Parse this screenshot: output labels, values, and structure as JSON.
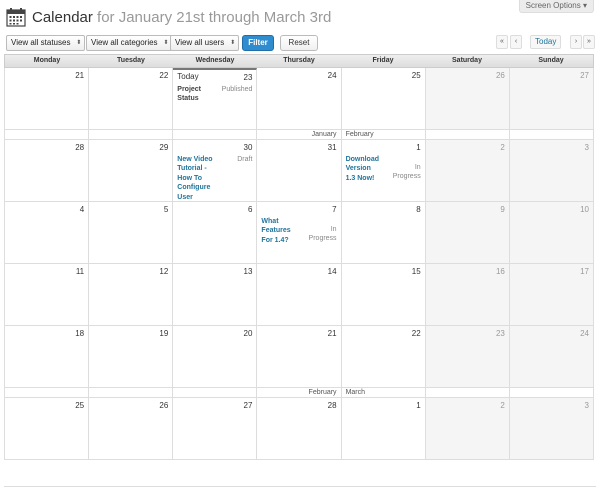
{
  "screen_options": "Screen Options ▾",
  "header": {
    "title": "Calendar",
    "range": " for January 21st through March 3rd"
  },
  "filters": {
    "statuses": "View all statuses",
    "categories": "View all categories",
    "users": "View all users",
    "filter_label": "Filter",
    "reset_label": "Reset"
  },
  "nav": {
    "first": "«",
    "prev": "‹",
    "today": "Today",
    "next": "›",
    "last": "»"
  },
  "weekdays": [
    "Monday",
    "Tuesday",
    "Wednesday",
    "Thursday",
    "Friday",
    "Saturday",
    "Sunday"
  ],
  "today_label": "Today",
  "weeks": [
    {
      "days": [
        "21",
        "22",
        "23",
        "24",
        "25",
        "26",
        "27"
      ]
    },
    {
      "days": [
        "28",
        "29",
        "30",
        "31",
        "1",
        "2",
        "3"
      ]
    },
    {
      "days": [
        "4",
        "5",
        "6",
        "7",
        "8",
        "9",
        "10"
      ]
    },
    {
      "days": [
        "11",
        "12",
        "13",
        "14",
        "15",
        "16",
        "17"
      ]
    },
    {
      "days": [
        "18",
        "19",
        "20",
        "21",
        "22",
        "23",
        "24"
      ]
    },
    {
      "days": [
        "25",
        "26",
        "27",
        "28",
        "1",
        "2",
        "3"
      ]
    }
  ],
  "month_separators": [
    {
      "end": "January",
      "start": "February"
    },
    {
      "end": "February",
      "start": "March"
    }
  ],
  "posts": {
    "project_status": {
      "title": "Project Status",
      "status": "Published"
    },
    "video_tutorial": {
      "title": "New Video Tutorial - How To Configure User Options",
      "status": "Draft"
    },
    "download": {
      "title": "Download Version 1.3 Now!",
      "status": "In Progress"
    },
    "features": {
      "title": "What Features For 1.4?",
      "status": "In Progress"
    }
  },
  "colors": {
    "primary": "#2e8ccf",
    "link": "#21759b",
    "weekend": "#f5f5f5"
  }
}
